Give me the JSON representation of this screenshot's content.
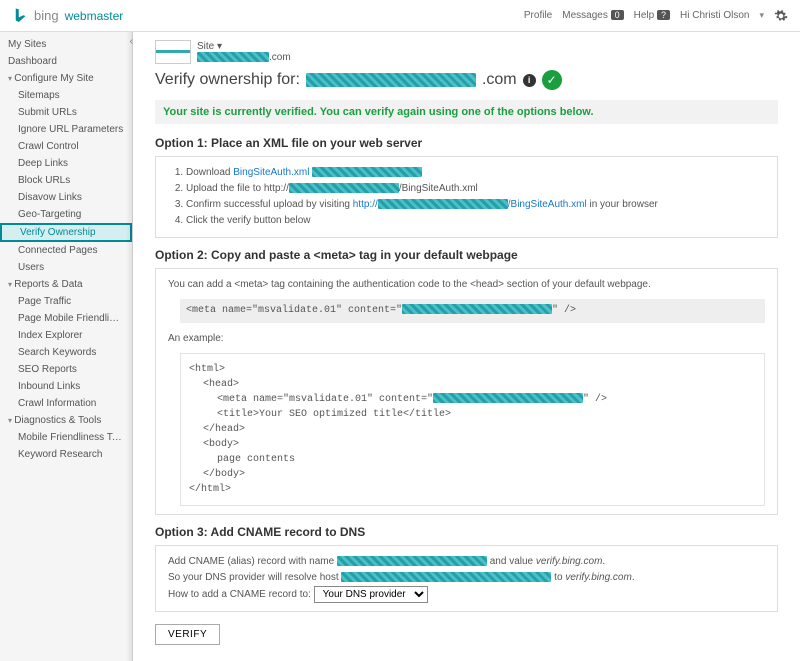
{
  "header": {
    "brand": "bing",
    "product": "webmaster",
    "links": {
      "profile": "Profile",
      "messages": "Messages",
      "help": "Help"
    },
    "badges": {
      "messages": "0",
      "help": "?"
    },
    "greeting": "Hi Christi Olson"
  },
  "sidebar": {
    "items": [
      {
        "id": "my-sites",
        "label": "My Sites",
        "type": "top"
      },
      {
        "id": "dashboard",
        "label": "Dashboard",
        "type": "top"
      },
      {
        "id": "configure",
        "label": "Configure My Site",
        "type": "exp-open"
      },
      {
        "id": "sitemaps",
        "label": "Sitemaps",
        "type": "child"
      },
      {
        "id": "submit-urls",
        "label": "Submit URLs",
        "type": "child"
      },
      {
        "id": "ignore-url",
        "label": "Ignore URL Parameters",
        "type": "child"
      },
      {
        "id": "crawl-control",
        "label": "Crawl Control",
        "type": "child"
      },
      {
        "id": "deep-links",
        "label": "Deep Links",
        "type": "child"
      },
      {
        "id": "block-urls",
        "label": "Block URLs",
        "type": "child"
      },
      {
        "id": "disavow",
        "label": "Disavow Links",
        "type": "child"
      },
      {
        "id": "geo",
        "label": "Geo-Targeting",
        "type": "child"
      },
      {
        "id": "verify",
        "label": "Verify Ownership",
        "type": "child-sel"
      },
      {
        "id": "connected",
        "label": "Connected Pages",
        "type": "child"
      },
      {
        "id": "users",
        "label": "Users",
        "type": "child"
      },
      {
        "id": "reports",
        "label": "Reports & Data",
        "type": "exp-open"
      },
      {
        "id": "traffic",
        "label": "Page Traffic",
        "type": "child"
      },
      {
        "id": "mobile-friend",
        "label": "Page Mobile Friendliness",
        "type": "child"
      },
      {
        "id": "index-exp",
        "label": "Index Explorer",
        "type": "child"
      },
      {
        "id": "search-kw",
        "label": "Search Keywords",
        "type": "child"
      },
      {
        "id": "seo-rep",
        "label": "SEO Reports",
        "type": "child"
      },
      {
        "id": "inbound",
        "label": "Inbound Links",
        "type": "child"
      },
      {
        "id": "crawl-info",
        "label": "Crawl Information",
        "type": "child"
      },
      {
        "id": "diag",
        "label": "Diagnostics & Tools",
        "type": "exp-open"
      },
      {
        "id": "mobile-test",
        "label": "Mobile Friendliness Test",
        "type": "child"
      },
      {
        "id": "kw-research",
        "label": "Keyword Research",
        "type": "child"
      }
    ]
  },
  "main": {
    "site_label": "Site",
    "site_suffix": ".com",
    "title": "Verify ownership for:",
    "title_suffix": ".com",
    "verified": "Your site is currently verified. You can verify again using one of the options below.",
    "opt1": {
      "heading": "Option 1: Place an XML file on your web server",
      "step1_a": "Download ",
      "step1_link": "BingSiteAuth.xml",
      "step2_a": "Upload the file to http://",
      "step2_b": "/BingSiteAuth.xml",
      "step3_a": "Confirm successful upload by visiting ",
      "step3_link": "http://",
      "step3_b": "/BingSiteAuth.xml",
      "step3_c": " in your browser",
      "step4": "Click the verify button below"
    },
    "opt2": {
      "heading": "Option 2: Copy and paste a <meta> tag in your default webpage",
      "intro": "You can add a <meta> tag containing the authentication code to the <head> section of your default webpage.",
      "meta_a": "<meta name=\"msvalidate.01\" content=\"",
      "meta_b": "\" />",
      "example_label": "An example:",
      "code_lines": [
        "<html>",
        "  <head>",
        "    <meta name=\"msvalidate.01\" content=\"",
        "    <title>Your SEO optimized title</title>",
        "  </head>",
        "  <body>",
        "    page contents",
        "  </body>",
        "</html>"
      ],
      "code_line2_suffix": "\" />"
    },
    "opt3": {
      "heading": "Option 3: Add CNAME record to DNS",
      "line1_a": "Add CNAME (alias) record with name ",
      "line1_b": " and value ",
      "line1_val": "verify.bing.com",
      "line2_a": "So your DNS provider will resolve host ",
      "line2_b": " to ",
      "line2_val": "verify.bing.com",
      "howto": "How to add a CNAME record to:",
      "select": "Your DNS provider"
    },
    "verify_btn": "VERIFY"
  }
}
